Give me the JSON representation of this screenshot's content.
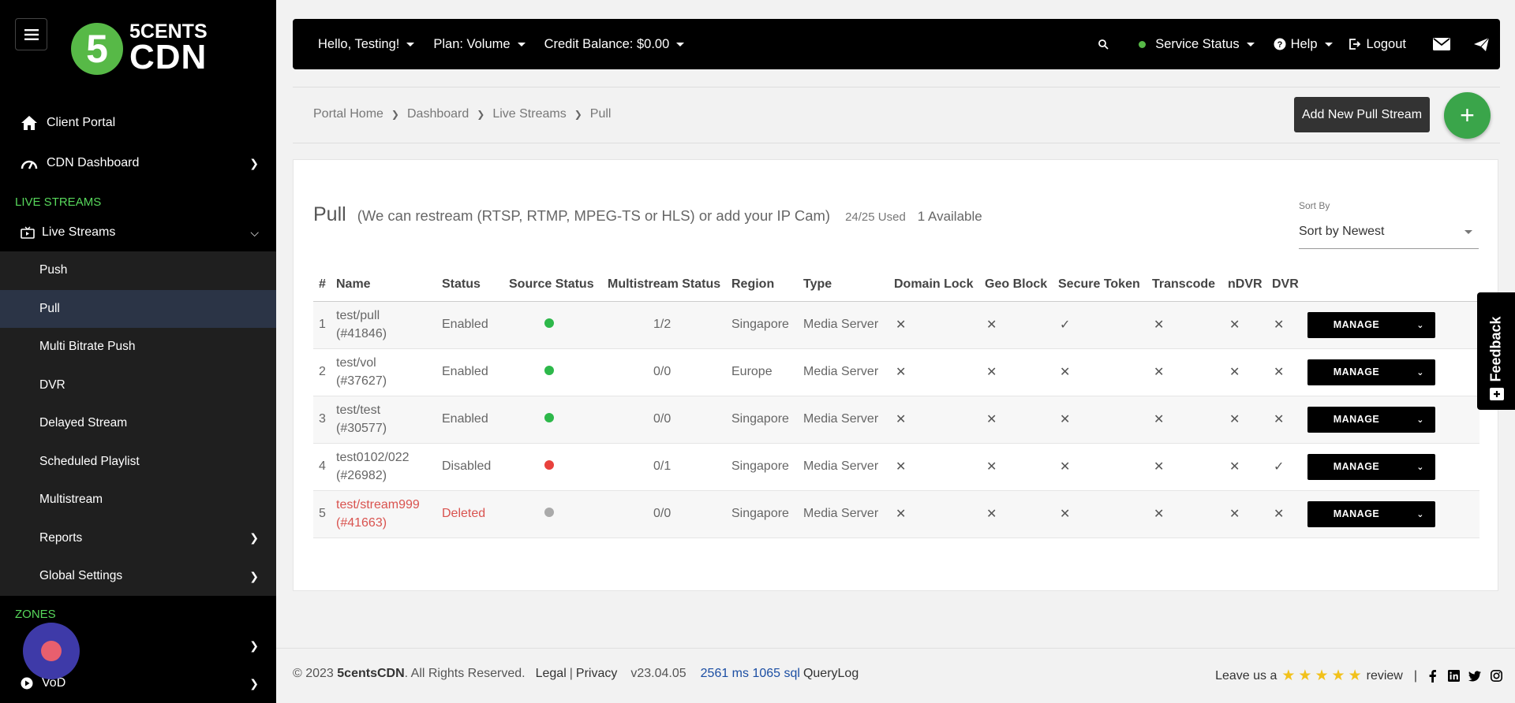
{
  "brand": {
    "logo_digit": "5",
    "logo_line1": "5CENTS",
    "logo_line2": "CDN"
  },
  "sidebar": {
    "client_portal": "Client Portal",
    "cdn_dashboard": "CDN Dashboard",
    "section_live": "LIVE STREAMS",
    "live_streams": "Live Streams",
    "sub_items": [
      "Push",
      "Pull",
      "Multi Bitrate Push",
      "DVR",
      "Delayed Stream",
      "Scheduled Playlist",
      "Multistream",
      "Reports",
      "Global Settings"
    ],
    "active_item": "Pull",
    "section_zones": "ZONES",
    "vod": "VoD"
  },
  "topbar": {
    "greeting": "Hello, Testing!",
    "plan": "Plan: Volume",
    "credit": "Credit Balance: $0.00",
    "service_status": "Service Status",
    "help": "Help",
    "logout": "Logout",
    "status_color": "#57b947"
  },
  "breadcrumb": [
    "Portal Home",
    "Dashboard",
    "Live Streams",
    "Pull"
  ],
  "add_button": "Add New Pull Stream",
  "fab_label": "+",
  "card": {
    "title": "Pull",
    "description": "(We can restream (RTSP, RTMP, MPEG-TS or HLS) or add your IP Cam)",
    "used": "24/25 Used",
    "available": "1 Available",
    "sort_label": "Sort By",
    "sort_value": "Sort by Newest"
  },
  "table": {
    "headers": [
      "#",
      "Name",
      "Status",
      "Source Status",
      "Multistream Status",
      "Region",
      "Type",
      "Domain Lock",
      "Geo Block",
      "Secure Token",
      "Transcode",
      "nDVR",
      "DVR"
    ],
    "manage_label": "MANAGE",
    "rows": [
      {
        "num": "1",
        "name": "test/pull",
        "id": "(#41846)",
        "status": "Enabled",
        "source": "green",
        "multistream": "1/2",
        "region": "Singapore",
        "type": "Media Server",
        "domain_lock": "✕",
        "geo_block": "✕",
        "secure_token": "✓",
        "transcode": "✕",
        "ndvr": "✕",
        "dvr": "✕",
        "deleted": false
      },
      {
        "num": "2",
        "name": "test/vol",
        "id": "(#37627)",
        "status": "Enabled",
        "source": "green",
        "multistream": "0/0",
        "region": "Europe",
        "type": "Media Server",
        "domain_lock": "✕",
        "geo_block": "✕",
        "secure_token": "✕",
        "transcode": "✕",
        "ndvr": "✕",
        "dvr": "✕",
        "deleted": false
      },
      {
        "num": "3",
        "name": "test/test",
        "id": "(#30577)",
        "status": "Enabled",
        "source": "green",
        "multistream": "0/0",
        "region": "Singapore",
        "type": "Media Server",
        "domain_lock": "✕",
        "geo_block": "✕",
        "secure_token": "✕",
        "transcode": "✕",
        "ndvr": "✕",
        "dvr": "✕",
        "deleted": false
      },
      {
        "num": "4",
        "name": "test0102/022",
        "id": "(#26982)",
        "status": "Disabled",
        "source": "red",
        "multistream": "0/1",
        "region": "Singapore",
        "type": "Media Server",
        "domain_lock": "✕",
        "geo_block": "✕",
        "secure_token": "✕",
        "transcode": "✕",
        "ndvr": "✕",
        "dvr": "✓",
        "deleted": false
      },
      {
        "num": "5",
        "name": "test/stream999",
        "id": "(#41663)",
        "status": "Deleted",
        "source": "gray",
        "multistream": "0/0",
        "region": "Singapore",
        "type": "Media Server",
        "domain_lock": "✕",
        "geo_block": "✕",
        "secure_token": "✕",
        "transcode": "✕",
        "ndvr": "✕",
        "dvr": "✕",
        "deleted": true
      }
    ]
  },
  "source_colors": {
    "green": "#2db84a",
    "red": "#e8413c",
    "gray": "#aaaaaa"
  },
  "feedback": "Feedback",
  "footer": {
    "copyright": "© 2023 ",
    "company": "5centsCDN",
    "rights": ". All Rights Reserved.",
    "legal": "Legal",
    "separator": "|",
    "privacy": "Privacy",
    "version": "v23.04.05",
    "perf": "2561 ms 1065 sql",
    "querylog": "QueryLog",
    "leave": "Leave us a",
    "review": "review",
    "pipe": "|"
  }
}
